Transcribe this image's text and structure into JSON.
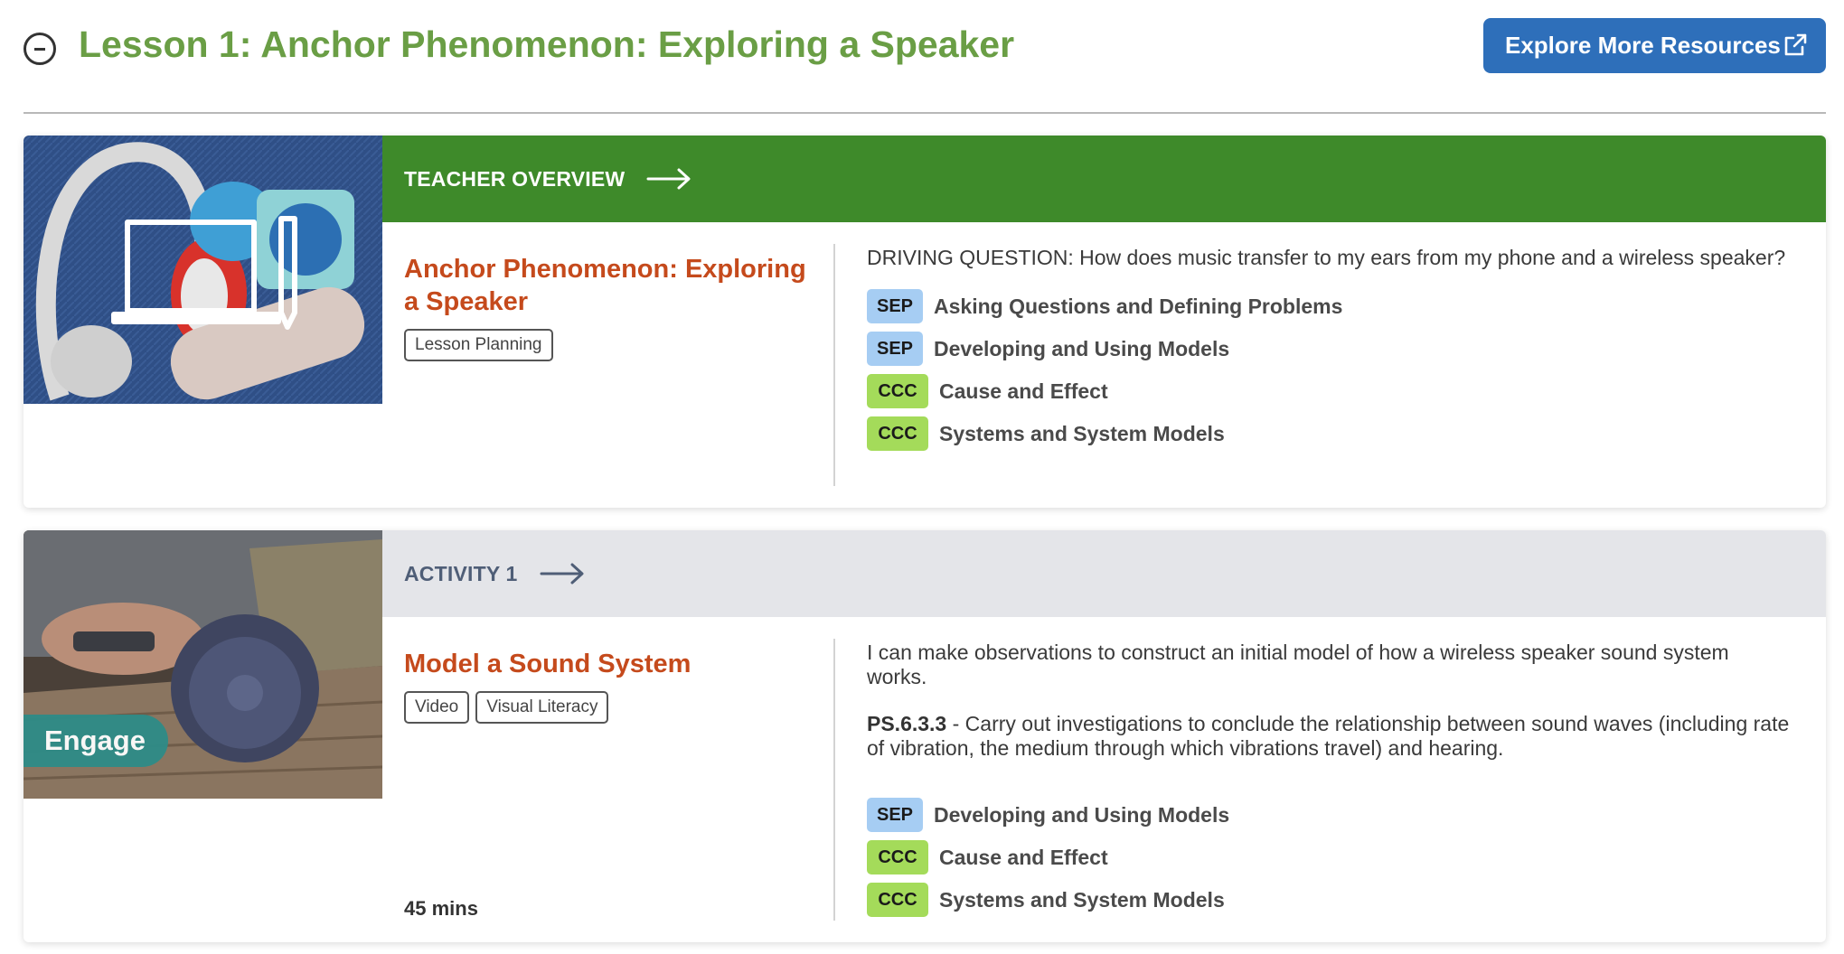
{
  "lesson": {
    "title": "Lesson 1: Anchor Phenomenon: Exploring a Speaker",
    "explore_button": "Explore More Resources"
  },
  "colors": {
    "lesson_title": "#6a9e45",
    "explore_button": "#2e6fba",
    "teacher_banner": "#3e8a2a",
    "activity_banner": "#e4e5e9",
    "activity_title": "#c54a1c",
    "sep_badge": "#a6cdf3",
    "ccc_badge": "#a4db5a",
    "engage_badge": "#2e8c88"
  },
  "teacher_overview": {
    "banner_label": "TEACHER OVERVIEW",
    "title": "Anchor Phenomenon: Exploring a Speaker",
    "tags": [
      "Lesson Planning"
    ],
    "driving_question": "DRIVING QUESTION: How does music transfer to my ears from my phone and a wireless speaker?",
    "standards": [
      {
        "type": "SEP",
        "label": "Asking Questions and Defining Problems"
      },
      {
        "type": "SEP",
        "label": "Developing and Using Models"
      },
      {
        "type": "CCC",
        "label": "Cause and Effect"
      },
      {
        "type": "CCC",
        "label": "Systems and System Models"
      }
    ]
  },
  "activity_1": {
    "banner_label": "ACTIVITY 1",
    "title": "Model a Sound System",
    "tags": [
      "Video",
      "Visual Literacy"
    ],
    "phase": "Engage",
    "duration": "45 mins",
    "objective": "I can make observations to construct an initial model of how a wireless speaker sound system works.",
    "standard_code": "PS.6.3.3",
    "standard_text": " - Carry out investigations to conclude the relationship between sound waves (including rate of vibration, the medium through which vibrations travel) and hearing.",
    "standards": [
      {
        "type": "SEP",
        "label": "Developing and Using Models"
      },
      {
        "type": "CCC",
        "label": "Cause and Effect"
      },
      {
        "type": "CCC",
        "label": "Systems and System Models"
      }
    ]
  }
}
